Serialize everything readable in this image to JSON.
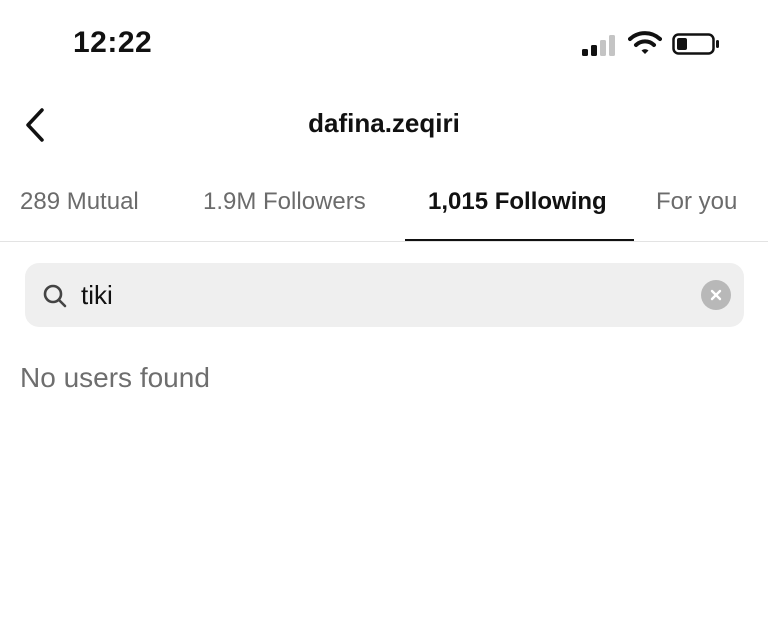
{
  "status_bar": {
    "time": "12:22"
  },
  "header": {
    "title": "dafina.zeqiri",
    "back_icon": "chevron-left-icon"
  },
  "tabs": [
    {
      "label": "289 Mutual",
      "active": false
    },
    {
      "label": "1.9M Followers",
      "active": false
    },
    {
      "label": "1,015 Following",
      "active": true
    },
    {
      "label": "For you",
      "active": false
    }
  ],
  "search": {
    "value": "tiki",
    "icon": "search-icon",
    "clear_icon": "clear-icon"
  },
  "results": {
    "empty_message": "No users found"
  },
  "colors": {
    "text_primary": "#111111",
    "text_secondary": "#6b6b6b",
    "search_background": "#efefef",
    "active_indicator": "#111111"
  }
}
